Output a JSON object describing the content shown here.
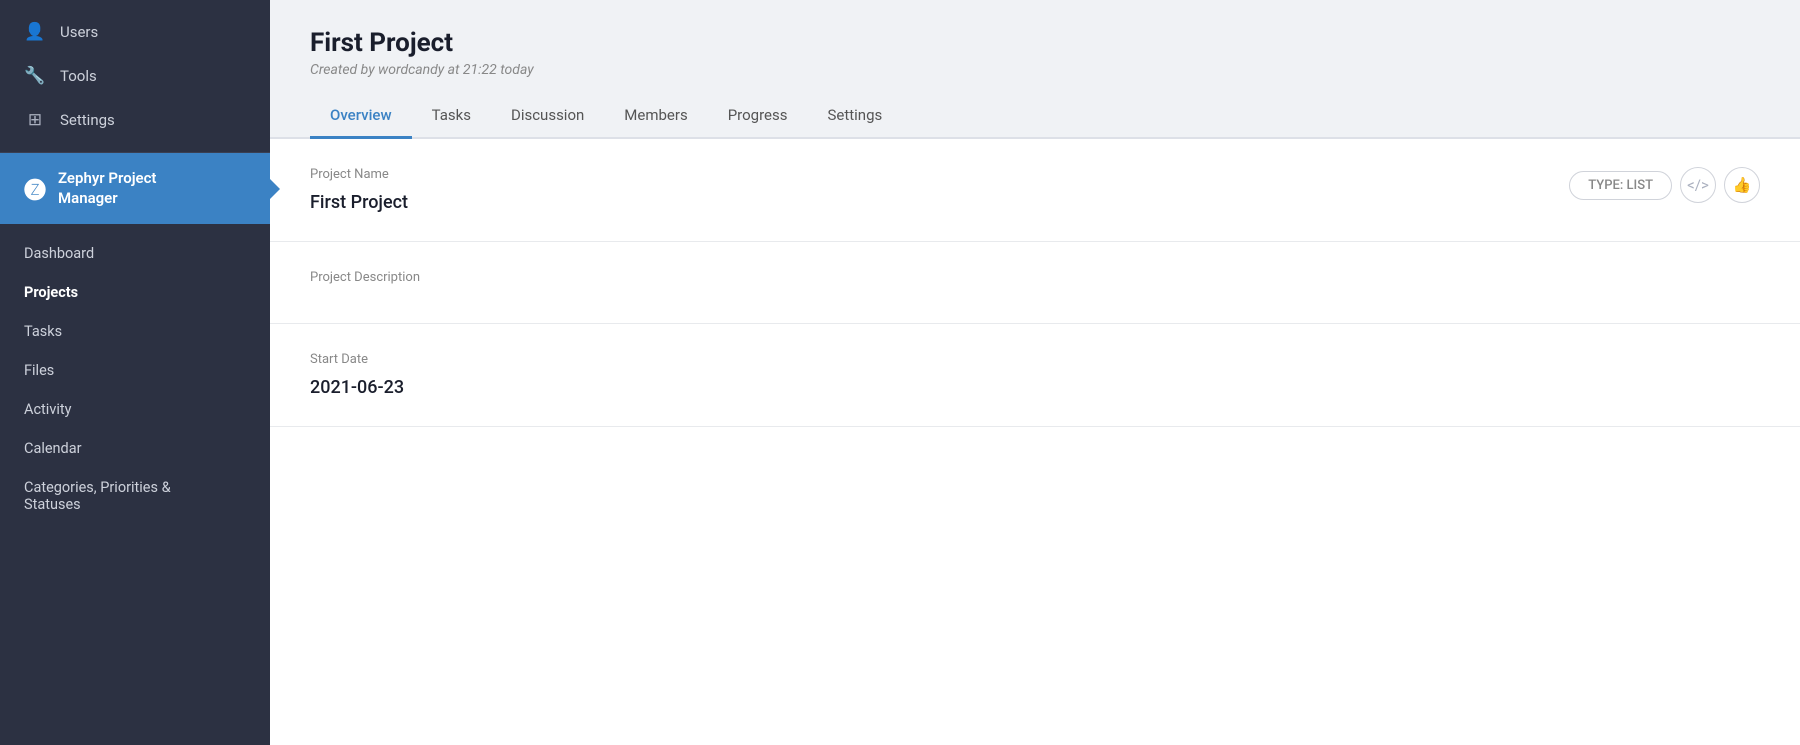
{
  "sidebar": {
    "top_nav": [
      {
        "id": "users",
        "label": "Users",
        "icon": "👤"
      },
      {
        "id": "tools",
        "label": "Tools",
        "icon": "🔧"
      },
      {
        "id": "settings",
        "label": "Settings",
        "icon": "⊞"
      }
    ],
    "plugin": {
      "icon": "𝖅",
      "label": "Zephyr Project\nManager"
    },
    "sub_nav": [
      {
        "id": "dashboard",
        "label": "Dashboard",
        "active": false
      },
      {
        "id": "projects",
        "label": "Projects",
        "active": true
      },
      {
        "id": "tasks",
        "label": "Tasks",
        "active": false
      },
      {
        "id": "files",
        "label": "Files",
        "active": false
      },
      {
        "id": "activity",
        "label": "Activity",
        "active": false
      },
      {
        "id": "calendar",
        "label": "Calendar",
        "active": false
      },
      {
        "id": "categories",
        "label": "Categories, Priorities &\nStatuses",
        "active": false
      }
    ]
  },
  "page": {
    "title": "First Project",
    "subtitle": "Created by wordcandy at 21:22 today",
    "tabs": [
      {
        "id": "overview",
        "label": "Overview",
        "active": true
      },
      {
        "id": "tasks",
        "label": "Tasks",
        "active": false
      },
      {
        "id": "discussion",
        "label": "Discussion",
        "active": false
      },
      {
        "id": "members",
        "label": "Members",
        "active": false
      },
      {
        "id": "progress",
        "label": "Progress",
        "active": false
      },
      {
        "id": "settings",
        "label": "Settings",
        "active": false
      }
    ]
  },
  "overview": {
    "project_name_label": "Project Name",
    "project_name_value": "First Project",
    "type_badge": "TYPE: LIST",
    "project_description_label": "Project Description",
    "project_description_value": "",
    "start_date_label": "Start Date",
    "start_date_value": "2021-06-23"
  },
  "icons": {
    "code": "</>",
    "thumbs_up": "👍",
    "users": "👤",
    "tools": "🔧",
    "settings_grid": "⊞"
  }
}
